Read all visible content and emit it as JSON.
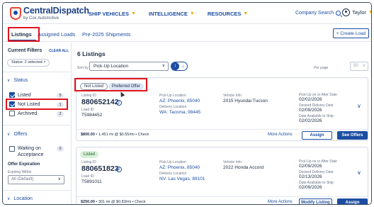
{
  "navbar": {
    "logo_name": "CentralDispatch",
    "logo_sub": "by Cox Automotive",
    "menu": [
      {
        "label": "SHIP VEHICLES"
      },
      {
        "label": "INTELLIGENCE"
      },
      {
        "label": "RESOURCES"
      }
    ],
    "company_search": "Company Search",
    "user_name": "Taylor"
  },
  "subtabs": {
    "items": [
      {
        "label": "Listings"
      },
      {
        "label": "Assigned Loads"
      },
      {
        "label": "Pre-2025 Shipments"
      }
    ],
    "create_load": "+ Create Load"
  },
  "filters": {
    "title": "Current Filters",
    "clear_all": "CLEAR ALL",
    "chip": "Status: 2 selected ×",
    "status_header": "Status",
    "status_items": [
      {
        "label": "Listed",
        "count": "5",
        "checked": true
      },
      {
        "label": "Not Listed",
        "count": "1",
        "checked": true
      },
      {
        "label": "Archived",
        "count": "2",
        "checked": false
      }
    ],
    "offers_header": "Offers",
    "offers_item_line1": "Waiting on",
    "offers_item_line2": "Acceptance",
    "offers_count": "0",
    "offer_expiration": "Offer Expiration",
    "expiring_within": "Expiring Within",
    "expiring_select": "All (Default)",
    "location_header": "Location"
  },
  "main": {
    "listings_count": "6 Listings",
    "sort_by_label": "Sort by",
    "sort_value": "Pick-Up Location",
    "per_page_label": "Per page",
    "per_page_value": "50"
  },
  "cards": [
    {
      "tags": [
        "Not Listed",
        "Preferred Offer"
      ],
      "listing_id_label": "Listing ID",
      "listing_id": "880652142",
      "load_id_label": "Load ID",
      "load_id": "T5984452",
      "pickup_label": "Pick-Up Location",
      "pickup": "AZ: Phoenix, 85040",
      "delivery_label": "Delivery Location",
      "delivery": "WA: Tacoma, 98445",
      "vehicle_label": "Vehicle Info",
      "vehicle": "2015 Hyundai Tucson",
      "date1_label": "Pick-Up on or After Date",
      "date1": "02/02/2026",
      "date2_label": "Desired Delivery Date",
      "date2": "02/09/2026",
      "date3_label": "Date Available to Ship",
      "date3": "02/02/2026",
      "price": "$800.00",
      "price_rest": " • 1,451 mi @ $0.55/mi • Check",
      "more_actions": "More Actions",
      "btn1": "Assign",
      "btn2": "See Offers"
    },
    {
      "tags": [
        "Listed"
      ],
      "listing_id_label": "Listing ID",
      "listing_id": "880651823",
      "load_id_label": "Load ID",
      "load_id": "T5891011",
      "pickup_label": "Pick-Up Location",
      "pickup": "AZ: Phoenix, 85040",
      "delivery_label": "Delivery Location",
      "delivery": "NV: Las Vegas, 89101",
      "vehicle_label": "Vehicle Info",
      "vehicle": "2022 Honda Accord",
      "date1_label": "Pick-Up on or After Date",
      "date1": "02/09/2026",
      "date2_label": "Desired Delivery Date",
      "date2": "02/13/2026",
      "date3_label": "Date Available to Ship",
      "date3": "02/09/2026",
      "price": "$250.00",
      "price_rest": " • 301 mi @ $0.83/mi • Check",
      "more_actions": "More Actions",
      "btn1": "Modify Listing",
      "btn2": "Assign"
    }
  ]
}
